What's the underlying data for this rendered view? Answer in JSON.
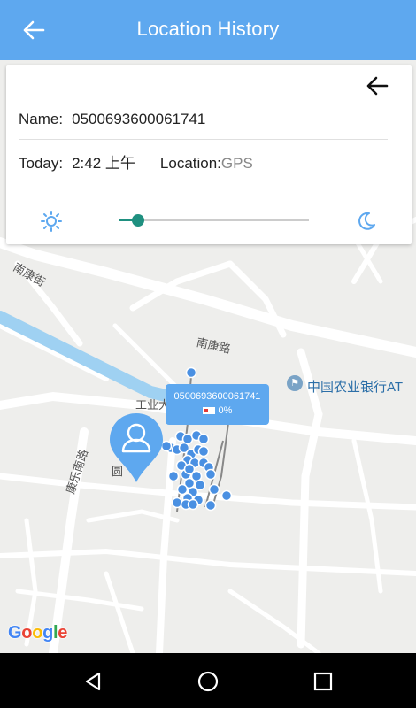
{
  "header": {
    "title": "Location History",
    "back_icon": "arrow-left-icon"
  },
  "info_card": {
    "close_icon": "arrow-left-icon",
    "name_label": "Name:",
    "name_value": "0500693600061741",
    "today_label": "Today:",
    "time_value": "2:42 上午",
    "location_label": "Location:",
    "location_value": "GPS",
    "brightness_icon": "sun-icon",
    "night_icon": "moon-icon",
    "slider_value_fraction": 0.1
  },
  "map": {
    "street_labels": [
      "南康街",
      "南康路",
      "工业大",
      "康乐南路",
      "圆"
    ],
    "poi_label": "中国农业银行AT",
    "popup_device_id": "0500693600061741",
    "popup_battery": "0%",
    "attribution": "Google",
    "accent": "#5ea8ef",
    "track_color": "#4a90e2"
  },
  "navbar": {
    "back": "nav-back-icon",
    "home": "nav-home-icon",
    "recents": "nav-recents-icon"
  }
}
